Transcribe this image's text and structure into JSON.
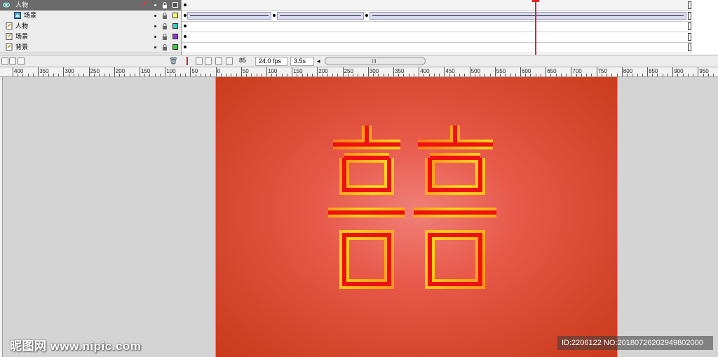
{
  "layers": [
    {
      "name": "人物",
      "selected": true,
      "indent": false,
      "color": "#555555"
    },
    {
      "name": "场景",
      "selected": false,
      "indent": true,
      "color": "#ffff66"
    },
    {
      "name": "人物",
      "selected": false,
      "indent": false,
      "color": "#33cccc"
    },
    {
      "name": "场景",
      "selected": false,
      "indent": false,
      "color": "#9933cc"
    },
    {
      "name": "背景",
      "selected": false,
      "indent": false,
      "color": "#33cc33"
    }
  ],
  "statusbar": {
    "frame": "85",
    "fps": "24.0 fps",
    "time": "3.5s",
    "scroll_grip": "III"
  },
  "ruler": {
    "labels": [
      "400",
      "350",
      "300",
      "250",
      "200",
      "150",
      "100",
      "50",
      "0",
      "50",
      "100",
      "150",
      "200",
      "250",
      "300",
      "350",
      "400",
      "450",
      "500",
      "550",
      "600",
      "650",
      "700",
      "750",
      "800",
      "850",
      "900",
      "950"
    ]
  },
  "watermark": {
    "left": "昵图网 www.nipic.com",
    "right": "ID:2206122 NO:20180726202949802000"
  },
  "colors": {
    "stage_center": "#f08078",
    "stage_edge": "#c93a18",
    "glyph_outer": "#ffd21a",
    "glyph_inner": "#ee1111"
  }
}
